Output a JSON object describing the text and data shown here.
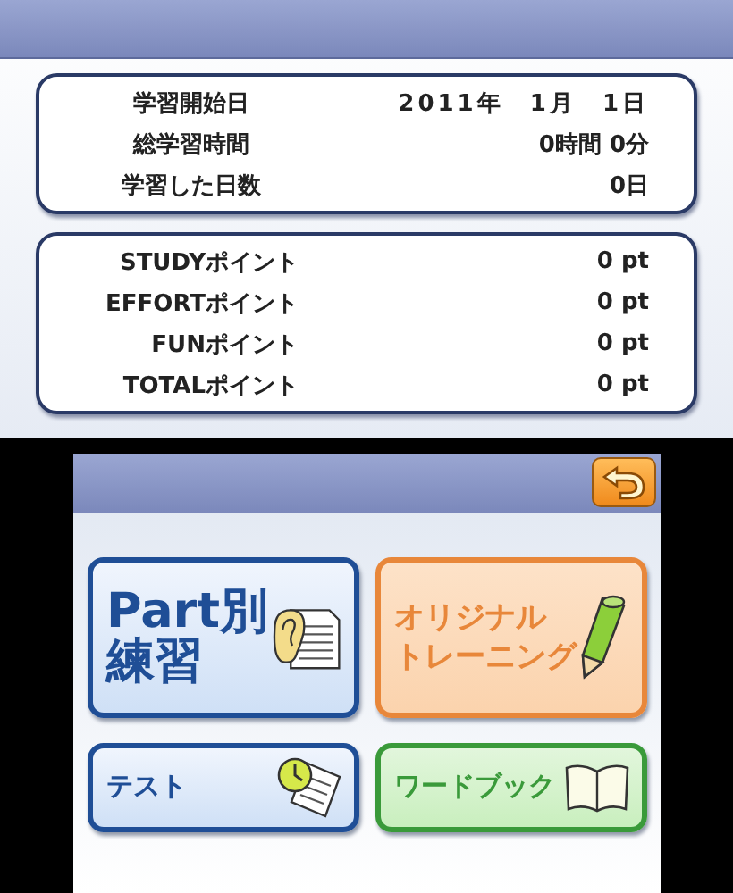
{
  "study_record": [
    {
      "label": "学習開始日",
      "value": "2011年 1月 1日"
    },
    {
      "label": "総学習時間",
      "value": "0時間 0分"
    },
    {
      "label": "学習した日数",
      "value": "0日"
    }
  ],
  "points": [
    {
      "label": "STUDYポイント",
      "value": "0 pt"
    },
    {
      "label": "EFFORTポイント",
      "value": "0 pt"
    },
    {
      "label": "FUNポイント",
      "value": "0 pt"
    },
    {
      "label": "TOTALポイント",
      "value": "0 pt"
    }
  ],
  "back_button": {
    "kind": "back"
  },
  "menu_rows": [
    [
      {
        "lines": [
          "Part別",
          "練習"
        ],
        "kind": "ear-document",
        "color": "#1f4e96"
      },
      {
        "lines": [
          "オリジナル",
          "トレーニング"
        ],
        "kind": "pencil",
        "color": "#e8873a"
      }
    ],
    [
      {
        "lines": [
          "テスト"
        ],
        "kind": "clock-document",
        "color": "#1f4e96"
      },
      {
        "lines": [
          "ワードブック"
        ],
        "kind": "book",
        "color": "#3a9a3a"
      }
    ]
  ]
}
